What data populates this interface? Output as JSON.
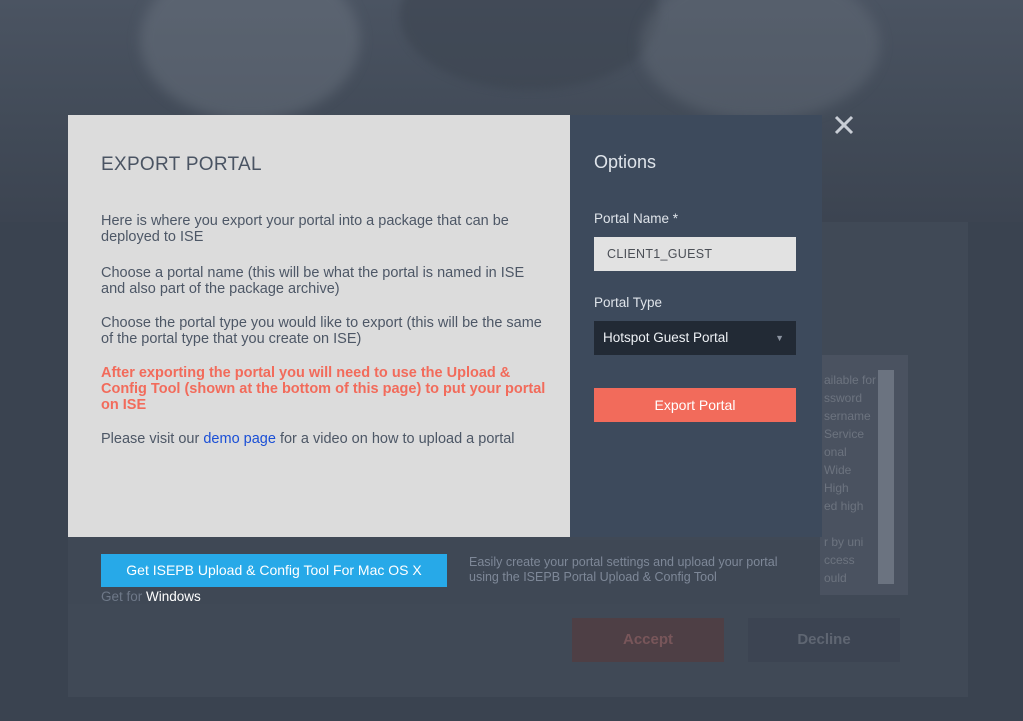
{
  "modal": {
    "title": "EXPORT PORTAL",
    "paragraphs": {
      "p1": "Here is where you export your portal into a package that can be deployed to ISE",
      "p2": "Choose a portal name (this will be what the portal is named in ISE and also part of the package archive)",
      "p3": "Choose the portal type you would like to export (this will be the same of the portal type that you create on ISE)",
      "warning": "After exporting the portal you will need to use the Upload & Config Tool (shown at the bottom of this page) to put your portal on ISE",
      "visit_prefix": "Please visit our ",
      "visit_link": "demo page",
      "visit_suffix": " for a video on how to upload a portal"
    }
  },
  "options": {
    "title": "Options",
    "portal_name_label": "Portal Name *",
    "portal_name_value": "CLIENT1_GUEST",
    "portal_type_label": "Portal Type",
    "portal_type_selected": "Hotspot Guest Portal",
    "export_button": "Export Portal"
  },
  "footer": {
    "mac_button": "Get ISEPB Upload & Config Tool For Mac OS X",
    "get_for_prefix": "Get for ",
    "windows_link": "Windows",
    "description": "Easily create your portal settings and upload your portal using the ISEPB Portal Upload & Config Tool"
  },
  "background": {
    "accept_button": "Accept",
    "decline_button": "Decline",
    "ghost_lines": [
      "ailable for",
      "ssword",
      "sername",
      "Service",
      "onal",
      "Wide",
      "High",
      "ed high",
      "r by uni",
      "ccess",
      "ould"
    ]
  },
  "colors": {
    "accent_red": "#f26b5b",
    "accent_blue": "#27a9e8",
    "panel_dark": "#3d4a5c",
    "panel_light": "#dcdcdc"
  },
  "icons": {
    "close": "close-icon",
    "dropdown": "chevron-down-icon"
  }
}
